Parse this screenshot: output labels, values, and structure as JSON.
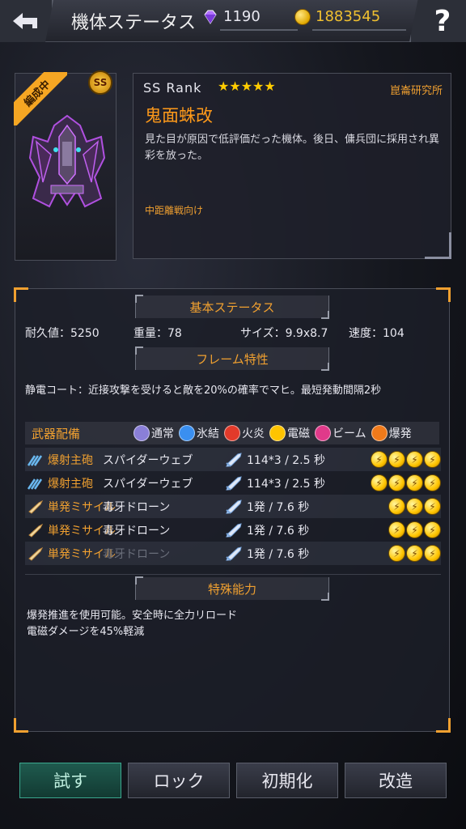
{
  "header": {
    "title": "機体ステータス",
    "gems": "1190",
    "coins": "1883545",
    "help_label": "?"
  },
  "ship": {
    "status_ribbon": "編成中",
    "grade_badge": "SS",
    "rank": "SS Rank",
    "stars": "★★★★★",
    "maker": "崑崙研究所",
    "name": "鬼面蛛改",
    "description": "見た目が原因で低評価だった機体。後日、傭兵団に採用され異彩を放った。",
    "role": "中距離戦向け"
  },
  "basic_status": {
    "header": "基本ステータス",
    "durability": "耐久値：5250",
    "weight": "重量：78",
    "size": "サイズ：9.9x8.7",
    "speed": "速度：104"
  },
  "frame": {
    "header": "フレーム特性",
    "text": "静電コート：近接攻撃を受けると敵を20%の確率でマヒ。最短発動間隔2秒"
  },
  "weapons": {
    "header": "武器配備",
    "legend": [
      {
        "label": "通常",
        "color": "#8a7fd8"
      },
      {
        "label": "氷結",
        "color": "#3a8ff0"
      },
      {
        "label": "火炎",
        "color": "#e23a2a"
      },
      {
        "label": "電磁",
        "color": "#ffc400"
      },
      {
        "label": "ビーム",
        "color": "#e03a8a"
      },
      {
        "label": "爆発",
        "color": "#f07a1a"
      }
    ],
    "rows": [
      {
        "type": "爆射主砲",
        "name": "スパイダーウェブ",
        "damage": "114*3 / 2.5 秒",
        "elements": 4,
        "dim": false,
        "icon": "web-icon"
      },
      {
        "type": "爆射主砲",
        "name": "スパイダーウェブ",
        "damage": "114*3 / 2.5 秒",
        "elements": 4,
        "dim": false,
        "icon": "web-icon"
      },
      {
        "type": "単発ミサイル",
        "name": "毒牙ドローン",
        "damage": "1発 / 7.6 秒",
        "elements": 3,
        "dim": false,
        "icon": "missile-icon"
      },
      {
        "type": "単発ミサイル",
        "name": "毒牙ドローン",
        "damage": "1発 / 7.6 秒",
        "elements": 3,
        "dim": false,
        "icon": "missile-icon"
      },
      {
        "type": "単発ミサイル",
        "name": "毒牙ドローン",
        "damage": "1発 / 7.6 秒",
        "elements": 3,
        "dim": true,
        "icon": "missile-icon"
      }
    ]
  },
  "special": {
    "header": "特殊能力",
    "line1": "爆発推進を使用可能。安全時に全力リロード",
    "line2": "電磁ダメージを45%軽減"
  },
  "buttons": {
    "try": "試す",
    "lock": "ロック",
    "reset": "初期化",
    "upgrade": "改造"
  },
  "colors": {
    "accent": "#f0a030",
    "name": "#ff9a1a",
    "primary_button": "#1f5a4e"
  }
}
